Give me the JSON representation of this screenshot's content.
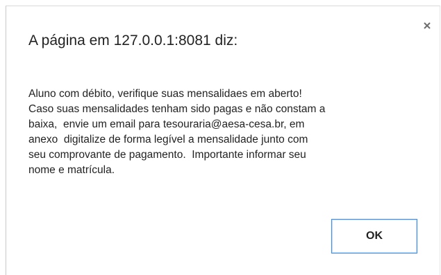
{
  "dialog": {
    "title": "A página em 127.0.0.1:8081 diz:",
    "message_lines": [
      "Aluno com débito, verifique suas mensalidaes em aberto!",
      "Caso suas mensalidades tenham sido pagas e não constam a",
      "baixa,  envie um email para tesouraria@aesa-cesa.br, em",
      "anexo  digitalize de forma legível a mensalidade junto com",
      "seu comprovante de pagamento.  Importante informar seu",
      "nome e matrícula."
    ],
    "ok_label": "OK",
    "close_icon": "close-icon",
    "accent_color": "#3c8df0"
  }
}
